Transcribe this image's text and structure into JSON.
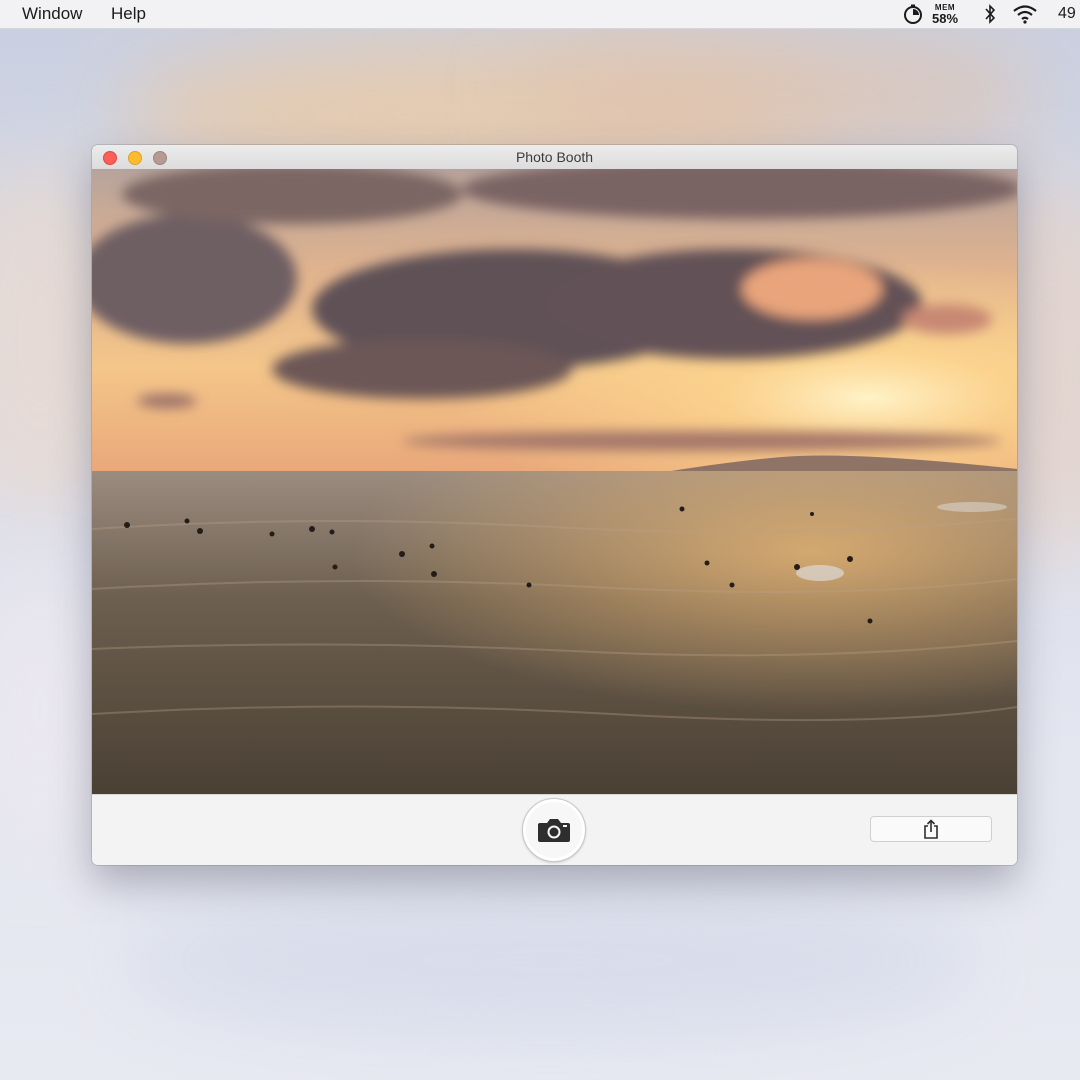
{
  "menubar": {
    "items": [
      {
        "label": "Window"
      },
      {
        "label": "Help"
      }
    ],
    "status": {
      "app_icon": "timer-icon",
      "mem_label": "MEM",
      "mem_value": "58%",
      "bluetooth_icon": "bluetooth-icon",
      "wifi_icon": "wifi-icon",
      "battery_text": "49"
    }
  },
  "window": {
    "title": "Photo Booth",
    "traffic_lights": {
      "close": "#fc5f57",
      "minimize": "#fdbc2e",
      "zoom": "#b69a92"
    }
  },
  "toolbar": {
    "shutter_icon": "camera-icon",
    "share_icon": "share-icon"
  }
}
